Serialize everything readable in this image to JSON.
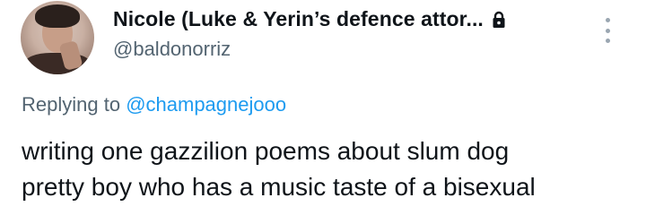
{
  "tweet": {
    "author": {
      "display_name": "Nicole (Luke & Yerin’s defence attor...",
      "handle": "@baldonorriz",
      "avatar_icon": "profile-photo",
      "protected_icon": "lock-icon"
    },
    "reply": {
      "prefix": "Replying to ",
      "mention": "@champagnejooo"
    },
    "text_line_1": "writing one gazzilion poems about slum dog",
    "text_line_2": "pretty boy who has a music taste of a bisexual",
    "more_icon": "more-vertical-icon"
  },
  "colors": {
    "text": "#0f1419",
    "secondary": "#536471",
    "link": "#1d9bf0"
  }
}
